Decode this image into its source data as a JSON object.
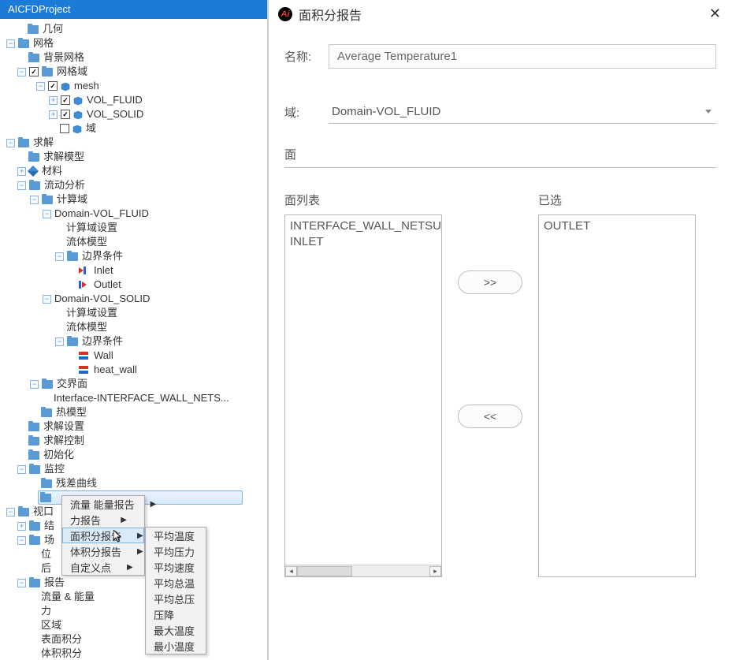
{
  "app": {
    "title": "AICFDProject"
  },
  "tree": {
    "geom": "几何",
    "mesh": "网格",
    "bg_mesh": "背景网格",
    "mesh_domain": "网格域",
    "mesh_label": "mesh",
    "vol_fluid": "VOL_FLUID",
    "vol_solid": "VOL_SOLID",
    "domain_item": "域",
    "solve": "求解",
    "solve_model": "求解模型",
    "material": "材料",
    "flow_analysis": "流动分析",
    "calc_domain": "计算域",
    "dom_fluid": "Domain-VOL_FLUID",
    "calc_settings": "计算域设置",
    "fluid_model": "流体模型",
    "bc": "边界条件",
    "inlet": "Inlet",
    "outlet": "Outlet",
    "dom_solid": "Domain-VOL_SOLID",
    "wall": "Wall",
    "heat_wall": "heat_wall",
    "interface": "交界面",
    "interface_item": "Interface-INTERFACE_WALL_NETS...",
    "thermal_model": "热模型",
    "solve_settings": "求解设置",
    "solve_control": "求解控制",
    "init": "初始化",
    "monitor": "监控",
    "residual": "残差曲线",
    "viewport": "视口",
    "vp_a": "结",
    "vp_b": "场",
    "vp_c": "位",
    "vp_d": "后",
    "report": "报告",
    "rep_flow_energy": "流量 & 能量",
    "rep_force": "力",
    "rep_region": "区域",
    "rep_surface_int": "表面积分",
    "rep_volume_int": "体积积分"
  },
  "ctx1": {
    "flow_energy": "流量 能量报告",
    "force": "力报告",
    "area_int": "面积分报告",
    "vol_int": "体积分报告",
    "custom": "自定义点"
  },
  "ctx2": {
    "avg_temp": "平均温度",
    "avg_press": "平均压力",
    "avg_vel": "平均速度",
    "avg_total_temp": "平均总温",
    "avg_total_press": "平均总压",
    "press_drop": "压降",
    "max_temp": "最大温度",
    "min_temp": "最小温度"
  },
  "dialog": {
    "title": "面积分报告",
    "name_label": "名称:",
    "name_value": "Average Temperature1",
    "domain_label": "域:",
    "domain_value": "Domain-VOL_FLUID",
    "face_label": "面",
    "list_label": "面列表",
    "selected_label": "已选",
    "list_items": [
      "INTERFACE_WALL_NETSU",
      "INLET"
    ],
    "selected_items": [
      "OUTLET"
    ],
    "add_btn": ">>",
    "remove_btn": "<<"
  }
}
